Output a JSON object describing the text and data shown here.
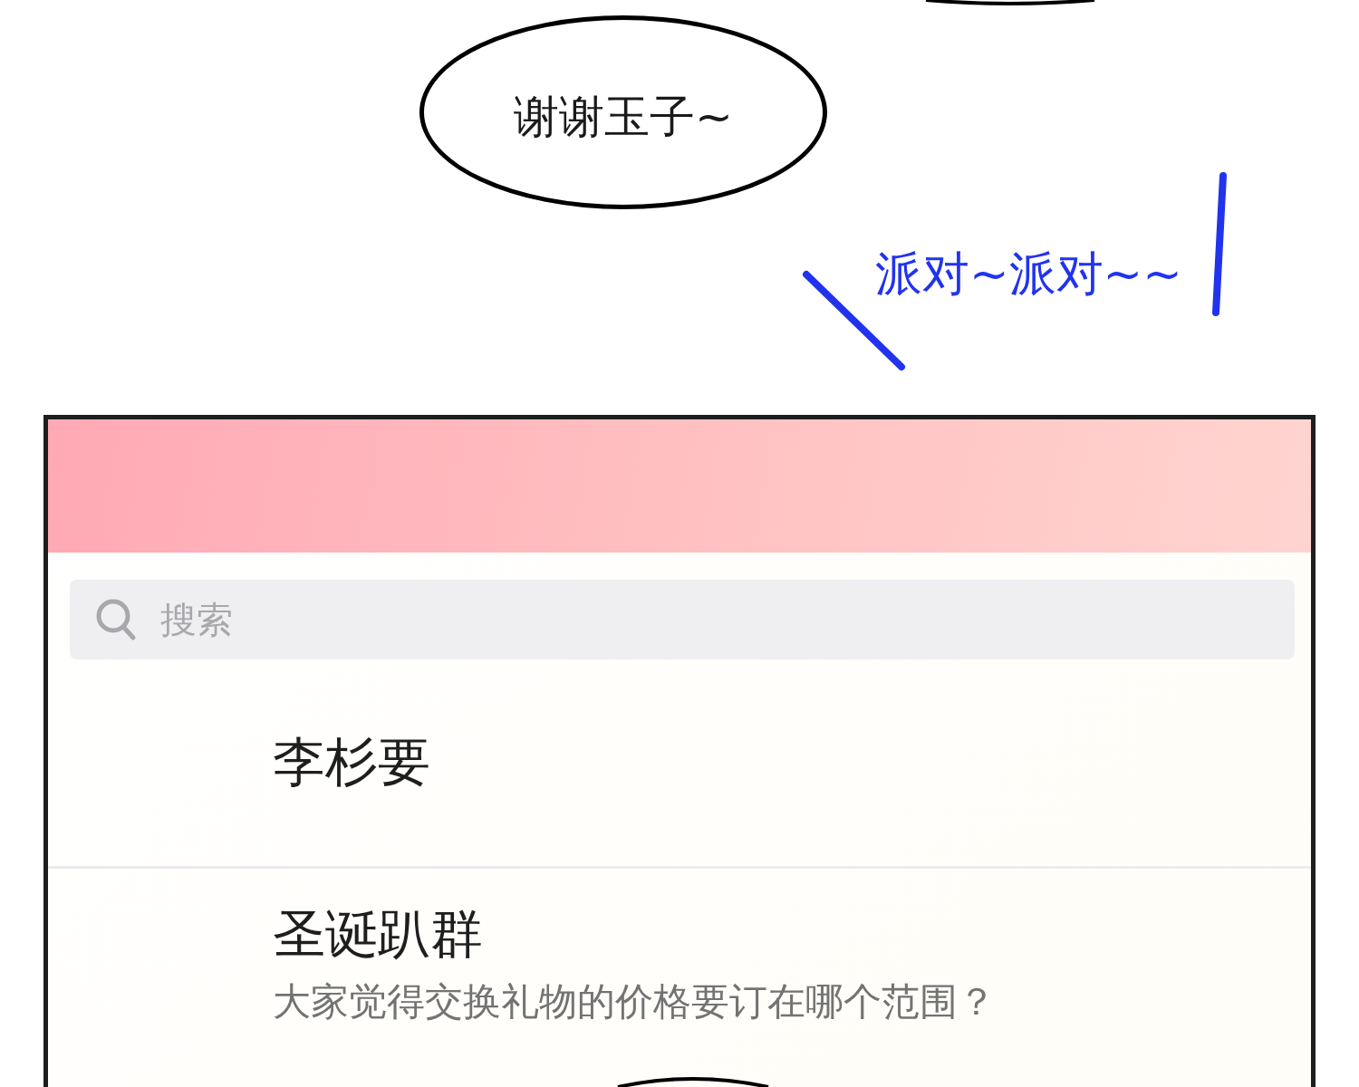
{
  "speech_bubble": {
    "text": "谢谢玉子~"
  },
  "sound_effect": {
    "text": "派对~派对~~"
  },
  "chat_app": {
    "search": {
      "placeholder": "搜索"
    },
    "chats": [
      {
        "name": "李杉要"
      },
      {
        "name": "圣诞趴群",
        "preview": "大家觉得交换礼物的价格要订在哪个范围？"
      }
    ]
  }
}
